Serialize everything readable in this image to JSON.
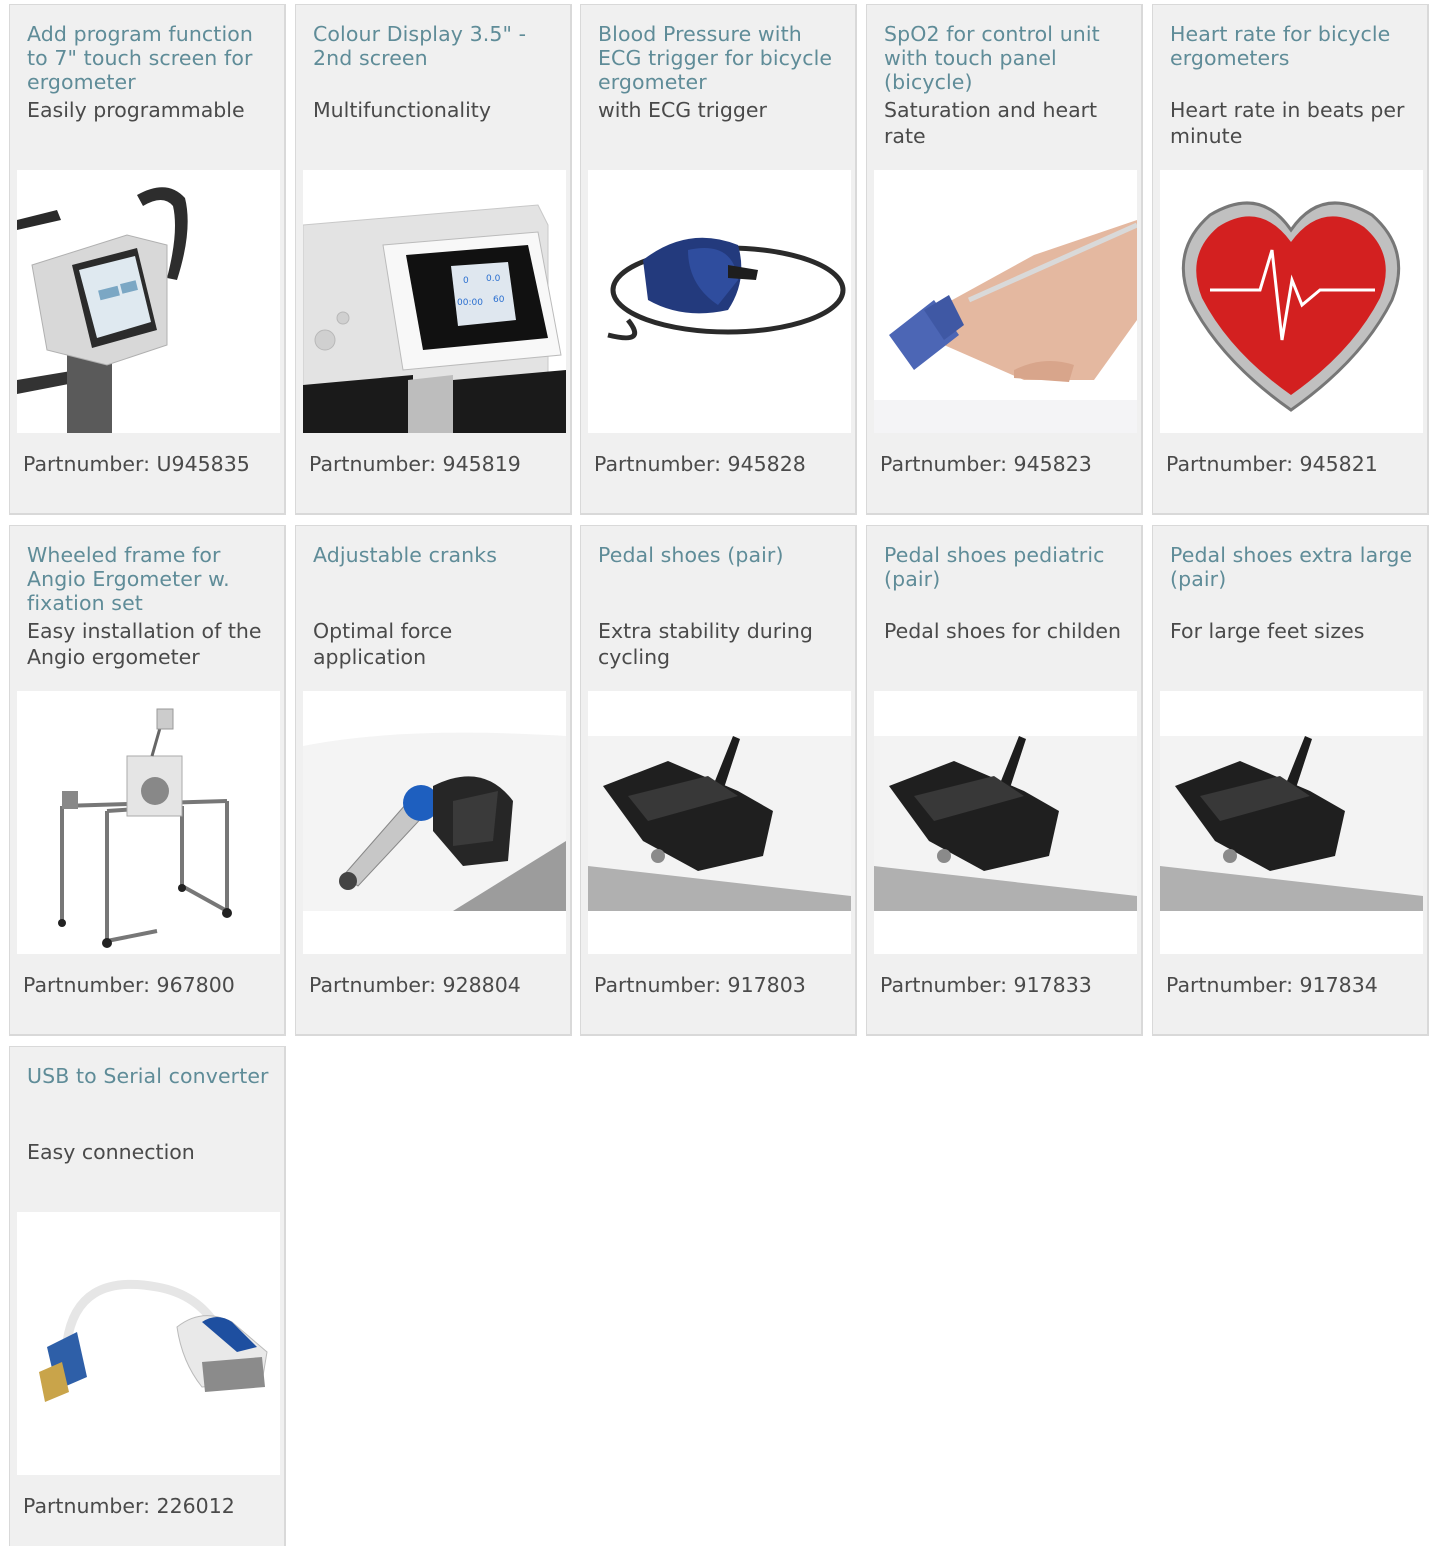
{
  "products": [
    {
      "title": "Add program function to 7\" touch screen for ergometer",
      "subtitle": "Easily programmable",
      "partnumber": "Partnumber: U945835",
      "image_icon": "touchscreen-display-image"
    },
    {
      "title": "Colour Display 3.5\" - 2nd screen",
      "subtitle": "Multifunctionality",
      "partnumber": "Partnumber: 945819",
      "image_icon": "colour-display-image"
    },
    {
      "title": "Blood Pressure with ECG trigger for bicycle ergometer",
      "subtitle": "with ECG trigger",
      "partnumber": "Partnumber: 945828",
      "image_icon": "blood-pressure-cuff-image"
    },
    {
      "title": "SpO2 for control unit with touch panel (bicycle)",
      "subtitle": "Saturation and heart rate",
      "partnumber": "Partnumber: 945823",
      "image_icon": "finger-sensor-image"
    },
    {
      "title": "Heart rate for bicycle ergometers",
      "subtitle": "Heart rate in beats per minute",
      "partnumber": "Partnumber: 945821",
      "image_icon": "heart-rate-image"
    },
    {
      "title": "Wheeled frame for Angio Ergometer w. fixation set",
      "subtitle": "Easy installation of the Angio ergometer",
      "partnumber": "Partnumber: 967800",
      "image_icon": "wheeled-frame-image"
    },
    {
      "title": "Adjustable cranks",
      "subtitle": "Optimal force application",
      "partnumber": "Partnumber: 928804",
      "image_icon": "adjustable-crank-image"
    },
    {
      "title": "Pedal shoes (pair)",
      "subtitle": "Extra stability during cycling",
      "partnumber": "Partnumber: 917803",
      "image_icon": "pedal-shoe-image"
    },
    {
      "title": "Pedal shoes pediatric (pair)",
      "subtitle": "Pedal shoes for childen",
      "partnumber": "Partnumber: 917833",
      "image_icon": "pedal-shoe-image"
    },
    {
      "title": "Pedal shoes extra large (pair)",
      "subtitle": "For large feet sizes",
      "partnumber": "Partnumber: 917834",
      "image_icon": "pedal-shoe-image"
    },
    {
      "title": "USB to Serial converter",
      "subtitle": "Easy connection",
      "partnumber": "Partnumber: 226012",
      "image_icon": "usb-serial-cable-image"
    }
  ],
  "display_texts": {
    "d1": "0",
    "d2": "0.0",
    "d3": "00:00",
    "d4": "60"
  },
  "colors": {
    "title": "#5f8c98",
    "text": "#4a4a4a",
    "card_bg": "#f0f0f0",
    "card_border": "#d9d9d9"
  }
}
